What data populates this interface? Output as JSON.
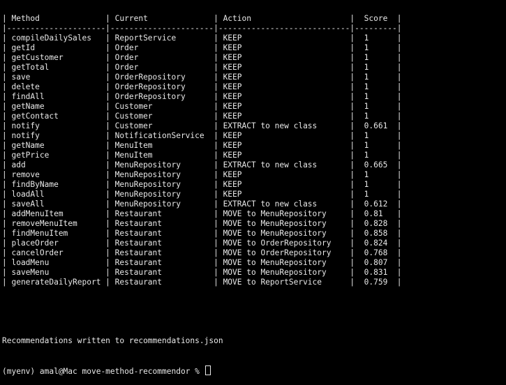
{
  "terminal": {
    "lines": [
      "| Method              | Current              | Action                     |  Score  |",
      "|---------------------|----------------------|----------------------------|---------|",
      "| compileDailySales   | ReportService        | KEEP                       |  1      |",
      "| getId               | Order                | KEEP                       |  1      |",
      "| getCustomer         | Order                | KEEP                       |  1      |",
      "| getTotal            | Order                | KEEP                       |  1      |",
      "| save                | OrderRepository      | KEEP                       |  1      |",
      "| delete              | OrderRepository      | KEEP                       |  1      |",
      "| findAll             | OrderRepository      | KEEP                       |  1      |",
      "| getName             | Customer             | KEEP                       |  1      |",
      "| getContact          | Customer             | KEEP                       |  1      |",
      "| notify              | Customer             | EXTRACT to new class       |  0.661  |",
      "| notify              | NotificationService  | KEEP                       |  1      |",
      "| getName             | MenuItem             | KEEP                       |  1      |",
      "| getPrice            | MenuItem             | KEEP                       |  1      |",
      "| add                 | MenuRepository       | EXTRACT to new class       |  0.665  |",
      "| remove              | MenuRepository       | KEEP                       |  1      |",
      "| findByName          | MenuRepository       | KEEP                       |  1      |",
      "| loadAll             | MenuRepository       | KEEP                       |  1      |",
      "| saveAll             | MenuRepository       | EXTRACT to new class       |  0.612  |",
      "| addMenuItem         | Restaurant           | MOVE to MenuRepository     |  0.81   |",
      "| removeMenuItem      | Restaurant           | MOVE to MenuRepository     |  0.828  |",
      "| findMenuItem        | Restaurant           | MOVE to MenuRepository     |  0.858  |",
      "| placeOrder          | Restaurant           | MOVE to OrderRepository    |  0.824  |",
      "| cancelOrder         | Restaurant           | MOVE to OrderRepository    |  0.768  |",
      "| loadMenu            | Restaurant           | MOVE to MenuRepository     |  0.807  |",
      "| saveMenu            | Restaurant           | MOVE to MenuRepository     |  0.831  |",
      "| generateDailyReport | Restaurant           | MOVE to ReportService      |  0.759  |"
    ],
    "message": "Recommendations written to recommendations.json",
    "prompt": "(myenv) amal@Mac move-method-recommendor % "
  }
}
